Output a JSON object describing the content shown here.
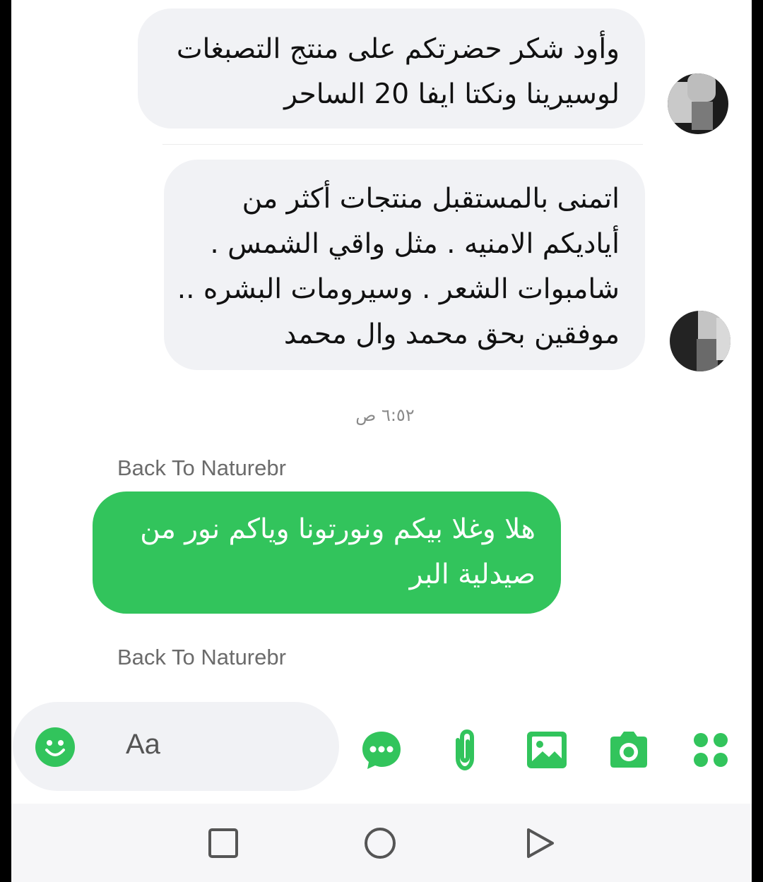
{
  "messages": [
    {
      "lines": [
        "وأود شكر حضرتكم على منتج التصبغات",
        "لوسيرينا ونكتا ايفا 20 الساحر"
      ]
    },
    {
      "lines": [
        "اتمنى بالمستقبل منتجات أكثر من",
        "أياديكم الامنيه . مثل واقي الشمس .",
        "شامبوات الشعر . وسيرومات البشره ..",
        "موفقين بحق محمد وال محمد"
      ]
    }
  ],
  "timestamp": "٦:٥٢ ص",
  "sender_name": "Back To Naturebr",
  "reply": {
    "lines": [
      "هلا وغلا بيكم ونورتونا وياكم نور من",
      "صيدلية البر"
    ]
  },
  "second_sender_name": "Back To Naturebr",
  "composer": {
    "placeholder": "Aa"
  },
  "toolbar": {
    "icons": [
      "emoji-icon",
      "chat-bubble-icon",
      "paperclip-icon",
      "image-icon",
      "camera-icon",
      "apps-grid-icon"
    ]
  },
  "navbar": {
    "icons": [
      "recents-square-icon",
      "home-circle-icon",
      "back-triangle-icon"
    ]
  },
  "colors": {
    "accent": "#32c45c",
    "incoming_bubble": "#f1f2f5"
  }
}
